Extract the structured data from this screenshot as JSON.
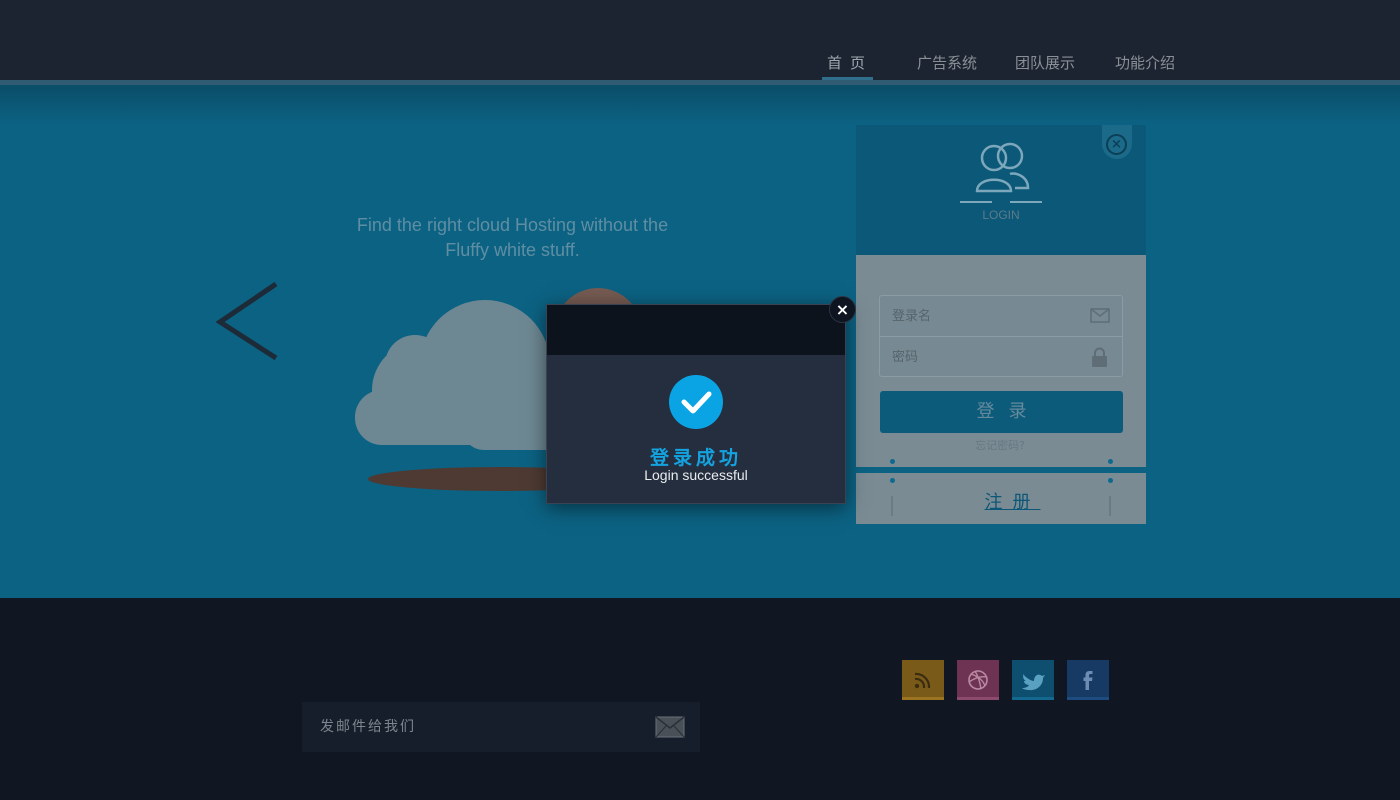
{
  "nav": {
    "items": [
      {
        "label": "首页"
      },
      {
        "label": "广告系统"
      },
      {
        "label": "团队展示"
      },
      {
        "label": "功能介绍"
      }
    ]
  },
  "hero": {
    "tagline": "Find the right cloud Hosting without the Fluffy white stuff."
  },
  "login": {
    "title": "LOGIN",
    "username_placeholder": "登录名",
    "password_placeholder": "密码",
    "submit_label": "登录",
    "forgot_label": "忘记密码?",
    "register_label": "注册"
  },
  "dialog": {
    "title": "登录成功",
    "subtitle": "Login successful",
    "close_glyph": "×",
    "status_color": "#13a3e0"
  },
  "footer": {
    "email_placeholder": "发邮件给我们",
    "social": [
      "rss-icon",
      "dribbble-icon",
      "twitter-icon",
      "facebook-icon"
    ]
  }
}
